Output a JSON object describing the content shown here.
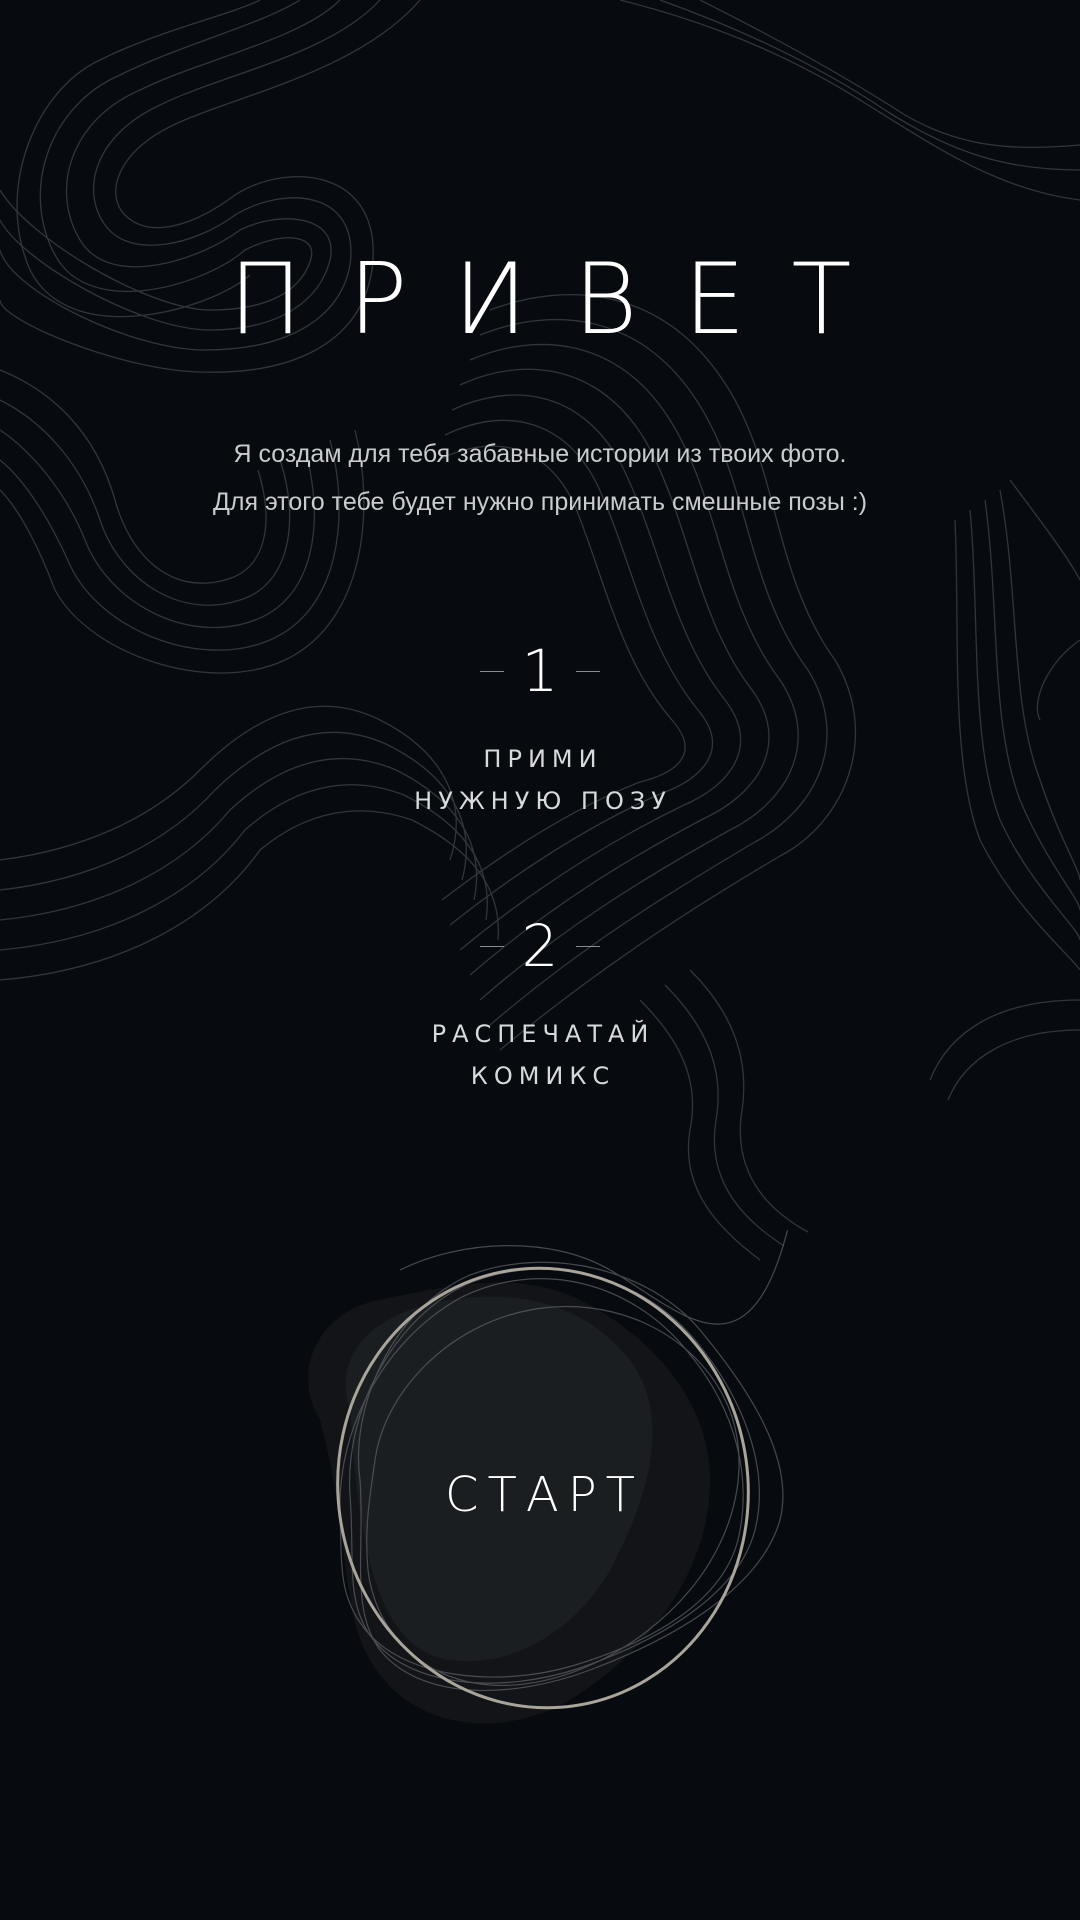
{
  "greeting": {
    "title": "ПРИВЕТ"
  },
  "intro": {
    "line1": "Я создам для тебя забавные истории из твоих фото.",
    "line2": "Для этого тебе будет нужно принимать смешные позы :)"
  },
  "steps": [
    {
      "number": "1",
      "line1": "ПРИМИ",
      "line2": "НУЖНУЮ ПОЗУ"
    },
    {
      "number": "2",
      "line1": "РАСПЕЧАТАЙ",
      "line2": "КОМИКС"
    }
  ],
  "start_button": {
    "label": "СТАРТ"
  },
  "colors": {
    "background": "#070b0f",
    "text": "#ffffff",
    "muted_text": "#c9cbcd",
    "ring": "#a9a59a",
    "contour": "#2a2f33"
  },
  "icons": {
    "background": "topographic-contour-lines",
    "button_ring": "organic-blob-outline"
  }
}
